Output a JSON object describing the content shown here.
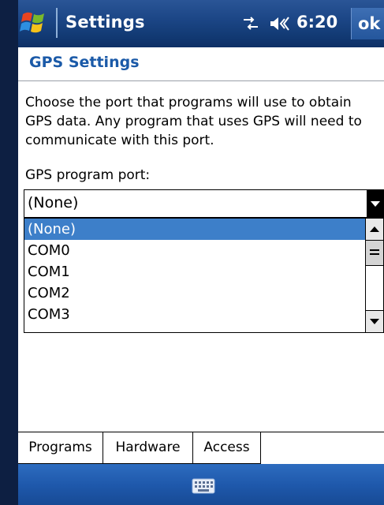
{
  "titlebar": {
    "title": "Settings",
    "clock": "6:20",
    "ok_label": "ok",
    "icons": [
      "windows-flag-icon",
      "connectivity-icon",
      "volume-icon"
    ]
  },
  "page": {
    "title": "GPS Settings",
    "description": "Choose the port that programs will use to obtain GPS data. Any program that uses GPS will need to communicate with this port.",
    "port_label": "GPS program port:"
  },
  "port_select": {
    "value": "(None)",
    "options": [
      "(None)",
      "COM0",
      "COM1",
      "COM2",
      "COM3"
    ],
    "highlighted_index": 0
  },
  "tabs": [
    {
      "label": "Programs",
      "active": true
    },
    {
      "label": "Hardware",
      "active": false
    },
    {
      "label": "Access",
      "active": false
    }
  ],
  "menubar": {
    "icon": "keyboard-icon"
  },
  "colors": {
    "title_accent": "#1b5aa8",
    "selection": "#3d7fc9",
    "bar_blue": "#1f59ac"
  }
}
